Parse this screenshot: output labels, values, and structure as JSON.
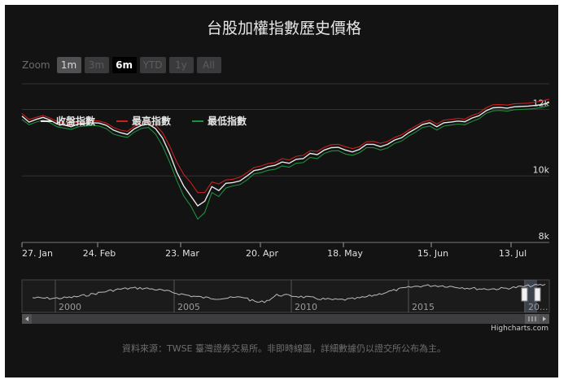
{
  "title": "台股加權指數歷史價格",
  "zoom": {
    "label": "Zoom",
    "buttons": [
      {
        "label": "1m",
        "state": "enabled"
      },
      {
        "label": "3m",
        "state": "disabled"
      },
      {
        "label": "6m",
        "state": "selected"
      },
      {
        "label": "YTD",
        "state": "disabled"
      },
      {
        "label": "1y",
        "state": "disabled"
      },
      {
        "label": "All",
        "state": "disabled"
      }
    ]
  },
  "credits": "Highcharts.com",
  "source_note": "資料來源：TWSE 臺灣證券交易所。非即時線圖，詳細數據仍以證交所公布為主。",
  "colors": {
    "close": "#e8e8e8",
    "high": "#cc1f1f",
    "low": "#1f8f3f",
    "navigator_line": "#bdbdbd",
    "grid": "#333333"
  },
  "navigator": {
    "year_labels": [
      "2000",
      "2005",
      "2010",
      "2015",
      "20..."
    ]
  },
  "chart_data": {
    "type": "line",
    "x_tick_labels": [
      "27. Jan",
      "24. Feb",
      "23. Mar",
      "20. Apr",
      "18. May",
      "15. Jun",
      "13. Jul"
    ],
    "y_tick_labels": [
      "8k",
      "10k",
      "12k"
    ],
    "ylim": [
      8000,
      12600
    ],
    "legend_placement": "top-left",
    "series": [
      {
        "name": "收盤指數",
        "values": [
          11800,
          11620,
          11700,
          11760,
          11680,
          11560,
          11530,
          11480,
          11560,
          11580,
          11600,
          11590,
          11520,
          11380,
          11300,
          11250,
          11420,
          11520,
          11560,
          11420,
          11140,
          10680,
          10120,
          9700,
          9400,
          9100,
          9240,
          9680,
          9560,
          9780,
          9800,
          9850,
          10000,
          10160,
          10200,
          10280,
          10320,
          10420,
          10380,
          10500,
          10520,
          10680,
          10640,
          10780,
          10850,
          10860,
          10780,
          10720,
          10800,
          10950,
          10950,
          10880,
          10950,
          11080,
          11150,
          11300,
          11420,
          11550,
          11600,
          11480,
          11600,
          11620,
          11650,
          11630,
          11740,
          11810,
          11960,
          12050,
          12060,
          12040,
          12080,
          12090,
          12100,
          12120,
          12150,
          12210
        ]
      },
      {
        "name": "最高指數",
        "values": [
          11880,
          11700,
          11760,
          11820,
          11740,
          11640,
          11600,
          11560,
          11620,
          11640,
          11660,
          11650,
          11590,
          11460,
          11380,
          11340,
          11500,
          11580,
          11620,
          11530,
          11300,
          10900,
          10420,
          10050,
          9800,
          9500,
          9500,
          9820,
          9760,
          9880,
          9900,
          9960,
          10100,
          10250,
          10300,
          10370,
          10400,
          10520,
          10480,
          10590,
          10620,
          10760,
          10740,
          10860,
          10940,
          10950,
          10880,
          10820,
          10880,
          11030,
          11040,
          10980,
          11040,
          11160,
          11240,
          11380,
          11500,
          11620,
          11680,
          11560,
          11680,
          11700,
          11730,
          11710,
          11820,
          11890,
          12050,
          12140,
          12150,
          12130,
          12170,
          12180,
          12190,
          12220,
          12260,
          12310
        ]
      },
      {
        "name": "最低指數",
        "values": [
          11700,
          11540,
          11620,
          11680,
          11600,
          11480,
          11440,
          11400,
          11480,
          11500,
          11520,
          11500,
          11420,
          11260,
          11200,
          11160,
          11320,
          11430,
          11460,
          11260,
          10900,
          10420,
          9880,
          9400,
          9100,
          8700,
          8900,
          9500,
          9380,
          9640,
          9700,
          9740,
          9880,
          10060,
          10100,
          10170,
          10200,
          10300,
          10260,
          10380,
          10400,
          10560,
          10520,
          10680,
          10750,
          10760,
          10660,
          10620,
          10700,
          10850,
          10850,
          10780,
          10840,
          10980,
          11050,
          11200,
          11320,
          11460,
          11500,
          11380,
          11500,
          11530,
          11560,
          11540,
          11640,
          11720,
          11880,
          11960,
          11970,
          11950,
          11990,
          12000,
          12010,
          12030,
          12060,
          12120
        ]
      }
    ]
  }
}
